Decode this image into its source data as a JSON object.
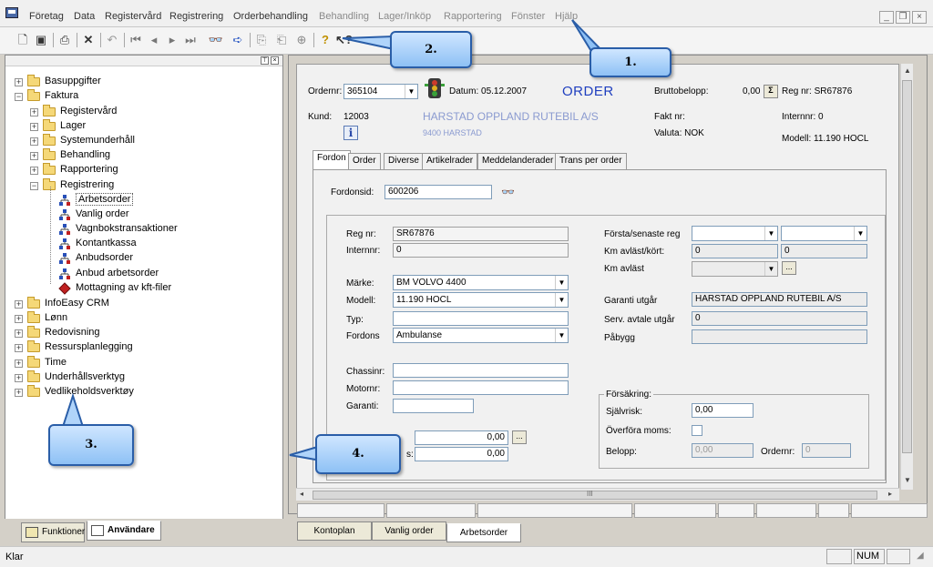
{
  "menu": [
    "Företag",
    "Data",
    "Registervård",
    "Registrering",
    "Orderbehandling",
    "Behandling",
    "Lager/Inköp",
    "Rapportering",
    "Fönster",
    "Hjälp"
  ],
  "mdi_controls": {
    "minimize": "_",
    "restore": "❐",
    "close": "×"
  },
  "tree": {
    "hdr_pin": "⊤",
    "hdr_close": "×",
    "items": [
      {
        "label": "Basuppgifter",
        "exp": "+"
      },
      {
        "label": "Faktura",
        "exp": "−"
      },
      {
        "label": "Registervård",
        "exp": "+"
      },
      {
        "label": "Lager",
        "exp": "+"
      },
      {
        "label": "Systemunderhåll",
        "exp": "+"
      },
      {
        "label": "Behandling",
        "exp": "+"
      },
      {
        "label": "Rapportering",
        "exp": "+"
      },
      {
        "label": "Registrering",
        "exp": "−"
      },
      {
        "label": "Arbetsorder"
      },
      {
        "label": "Vanlig order"
      },
      {
        "label": "Vagnbokstransaktioner"
      },
      {
        "label": "Kontantkassa"
      },
      {
        "label": "Anbudsorder"
      },
      {
        "label": "Anbud arbetsorder"
      },
      {
        "label": "Mottagning av kft-filer"
      },
      {
        "label": "InfoEasy CRM",
        "exp": "+"
      },
      {
        "label": "Lønn",
        "exp": "+"
      },
      {
        "label": "Redovisning",
        "exp": "+"
      },
      {
        "label": "Ressursplanlegging",
        "exp": "+"
      },
      {
        "label": "Time",
        "exp": "+"
      },
      {
        "label": "Underhållsverktyg",
        "exp": "+"
      },
      {
        "label": "Vedlikeholdsverktøy",
        "exp": "+"
      }
    ],
    "tabs": [
      "Funktioner",
      "Användare"
    ]
  },
  "order": {
    "ordernr_label": "Ordernr:",
    "ordernr": "365104",
    "datum": "Datum: 05.12.2007",
    "title": "ORDER",
    "brutto_label": "Bruttobelopp:",
    "brutto": "0,00",
    "sigma": "Σ",
    "regnr_header": "Reg nr: SR67876",
    "kund_label": "Kund:",
    "kund": "12003",
    "kund_name": "HARSTAD OPPLAND RUTEBIL A/S",
    "kund_addr": "9400 HARSTAD",
    "info": "i",
    "faktnr": "Fakt nr:",
    "valuta": "Valuta:  NOK",
    "internnr_header": "Internnr: 0",
    "modell_header": "Modell:  11.190 HOCL"
  },
  "tabs": [
    "Fordon",
    "Order",
    "Diverse",
    "Artikelrader",
    "Meddelanderader",
    "Trans per order"
  ],
  "fordon": {
    "fordonsid_label": "Fordonsid:",
    "fordonsid": "600206",
    "regnr_label": "Reg nr:",
    "regnr": "SR67876",
    "internnr_label": "Internnr:",
    "internnr": "0",
    "marke_label": "Märke:",
    "marke": "BM VOLVO 4400",
    "modell_label": "Modell:",
    "modell": "11.190 HOCL",
    "typ_label": "Typ:",
    "fordons_label": "Fordons",
    "fordons": "Ambulanse",
    "chassinr_label": "Chassinr:",
    "motornr_label": "Motornr:",
    "garanti_label": "Garanti:",
    "amount1": "0,00",
    "amount2": "0,00",
    "s_label": "s:",
    "ellipsis": "...",
    "forsta_label": "Första/senaste reg",
    "km_label": "Km avläst/kört:",
    "km1": "0",
    "km2": "0",
    "km_avlast_label": "Km avläst",
    "garanti_utgar_label": "Garanti utgår",
    "garanti_utgar": "HARSTAD OPPLAND RUTEBIL A/S",
    "serv_label": "Serv. avtale utgår",
    "serv": "0",
    "pabygg_label": "Påbygg",
    "forsakring_label": "Försäkring:",
    "sjalvrisk_label": "Självrisk:",
    "sjalvrisk": "0,00",
    "overfora_label": "Överföra moms:",
    "belopp_label": "Belopp:",
    "belopp": "0,00",
    "ordernr_label": "Ordernr:",
    "ordernr": "0"
  },
  "bottom_tabs": [
    "Kontoplan",
    "Vanlig order",
    "Arbetsorder"
  ],
  "status": {
    "text": "Klar",
    "num": "NUM"
  },
  "callouts": [
    "1.",
    "2.",
    "3.",
    "4."
  ],
  "hscroll_mark": "III",
  "colors": {
    "callout_fill": "#8ec1f5",
    "callout_border": "#2a5ea8",
    "order_title": "#1f3fbf",
    "customer_name": "#8a9ad0"
  }
}
